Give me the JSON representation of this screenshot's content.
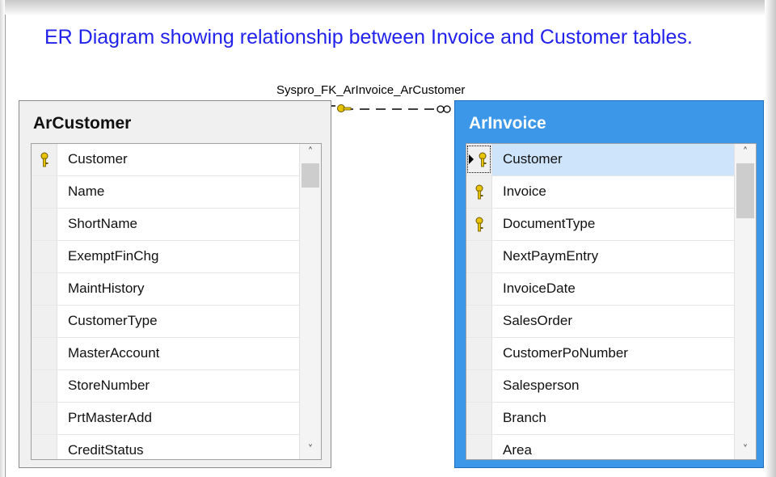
{
  "title": "ER Diagram showing relationship between Invoice and Customer tables.",
  "relationship": {
    "label": "Syspro_FK_ArInvoice_ArCustomer",
    "from": "ArInvoice",
    "to": "ArCustomer",
    "line_style": "dashed",
    "key_end": "ArCustomer",
    "many_end": "ArInvoice"
  },
  "tables": {
    "customer": {
      "name": "ArCustomer",
      "columns": [
        {
          "name": "Customer",
          "key": true
        },
        {
          "name": "Name",
          "key": false
        },
        {
          "name": "ShortName",
          "key": false
        },
        {
          "name": "ExemptFinChg",
          "key": false
        },
        {
          "name": "MaintHistory",
          "key": false
        },
        {
          "name": "CustomerType",
          "key": false
        },
        {
          "name": "MasterAccount",
          "key": false
        },
        {
          "name": "StoreNumber",
          "key": false
        },
        {
          "name": "PrtMasterAdd",
          "key": false
        },
        {
          "name": "CreditStatus",
          "key": false
        }
      ],
      "selected_color": "#f0f0f0"
    },
    "invoice": {
      "name": "ArInvoice",
      "selected": true,
      "header_color": "#3c97e8",
      "columns": [
        {
          "name": "Customer",
          "key": true,
          "selected": true
        },
        {
          "name": "Invoice",
          "key": true
        },
        {
          "name": "DocumentType",
          "key": true
        },
        {
          "name": "NextPaymEntry",
          "key": false
        },
        {
          "name": "InvoiceDate",
          "key": false
        },
        {
          "name": "SalesOrder",
          "key": false
        },
        {
          "name": "CustomerPoNumber",
          "key": false
        },
        {
          "name": "Salesperson",
          "key": false
        },
        {
          "name": "Branch",
          "key": false
        },
        {
          "name": "Area",
          "key": false
        }
      ]
    }
  },
  "icons": {
    "key": "key-icon",
    "row_pointer": "row-pointer-icon",
    "scroll_up": "chevron-up-icon",
    "scroll_down": "chevron-down-icon"
  },
  "colors": {
    "title": "#2222ee",
    "key_gold": "#e8c400",
    "selection": "#cde4fb"
  }
}
